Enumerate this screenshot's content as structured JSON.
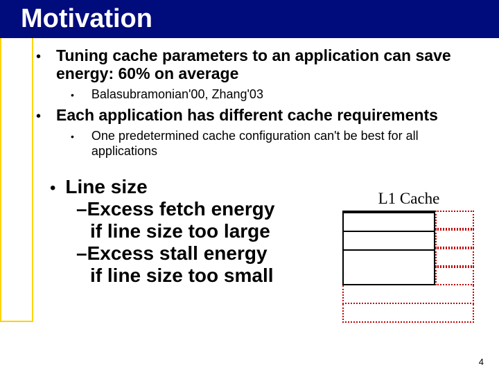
{
  "title": "Motivation",
  "bullets": [
    {
      "text": "Tuning cache parameters to an application can save energy: 60% on average",
      "subs": [
        {
          "text": "Balasubramonian'00, Zhang'03"
        }
      ]
    },
    {
      "text": "Each application has different cache requirements",
      "subs": [
        {
          "text": "One predetermined cache configuration can't be best for all applications"
        }
      ]
    }
  ],
  "lower": {
    "heading": "Line size",
    "dash1a": "–Excess fetch energy",
    "dash1b": "if line size too large",
    "dash2a": "–Excess stall energy",
    "dash2b": "if line size too small"
  },
  "cache_label": "L1 Cache",
  "page_number": "4"
}
